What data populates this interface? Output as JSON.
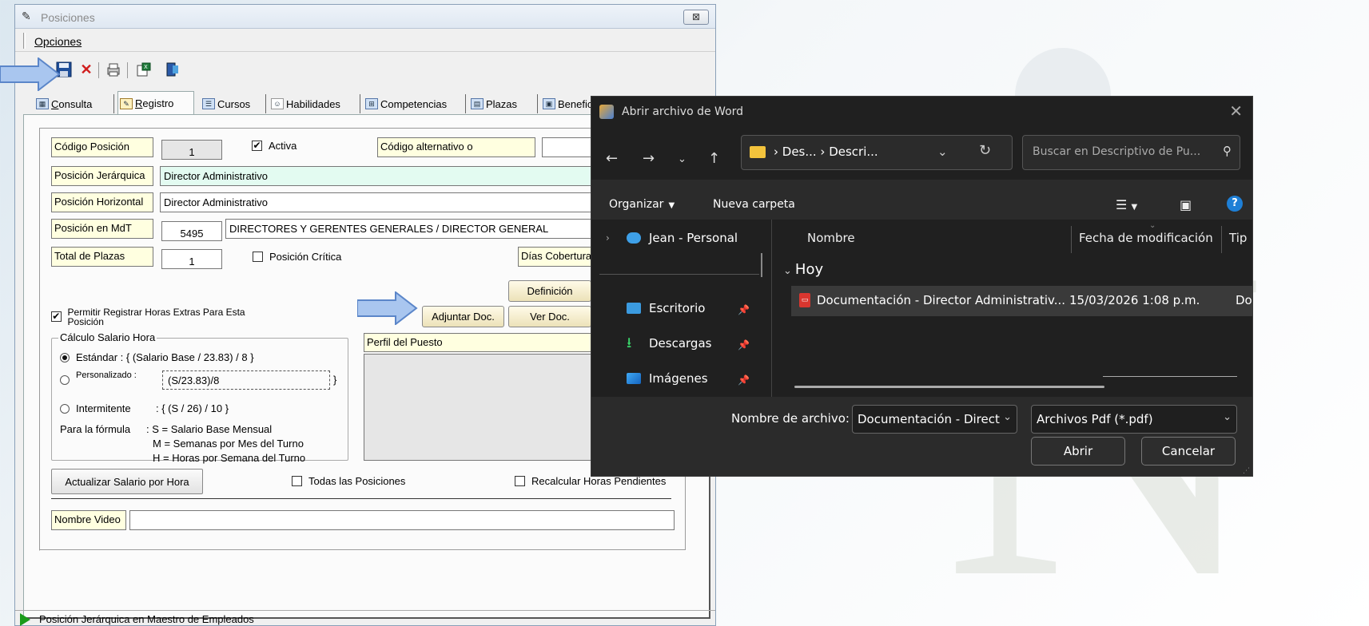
{
  "posiciones": {
    "title": "Posiciones",
    "close_label": "⊠",
    "menu": {
      "opciones": "Opciones"
    },
    "tabs": [
      {
        "label": "Consulta",
        "underline": "C",
        "rest": "onsulta"
      },
      {
        "label": "Registro",
        "underline": "R",
        "rest": "egistro"
      },
      {
        "label": "Cursos"
      },
      {
        "label": "Habilidades"
      },
      {
        "label": "Competencias"
      },
      {
        "label": "Plazas"
      },
      {
        "label": "Benefici"
      }
    ],
    "form": {
      "codigo_label": "Código Posición",
      "codigo_value": "1",
      "activa_label": "Activa",
      "codigo_alt_label": "Código alternativo o",
      "pos_jer_label": "Posición Jerárquica",
      "pos_jer_value": "Director Administrativo",
      "pos_hor_label": "Posición Horizontal",
      "pos_hor_value": "Director Administrativo",
      "pos_mdt_label": "Posición en MdT",
      "pos_mdt_code": "5495",
      "pos_mdt_desc": "DIRECTORES Y GERENTES GENERALES / DIRECTOR GENERAL",
      "total_plazas_label": "Total de Plazas",
      "total_plazas_value": "1",
      "pos_critica_label": "Posición Crítica",
      "dias_cobertura_label": "Días Cobertura",
      "definicion_btn": "Definición",
      "horas_extras_label": "Permitir Registrar Horas Extras Para Esta Posición",
      "adjuntar_btn": "Adjuntar Doc.",
      "ver_doc_btn": "Ver Doc.",
      "calculo_title": "Cálculo Salario Hora",
      "estandar_label": "Estándar : { (Salario Base / 23.83) / 8 }",
      "personalizado_label": "Personalizado :",
      "personalizado_value": "(S/23.83)/8",
      "personalizado_close": "}",
      "intermitente_label": "Intermitente",
      "intermitente_formula": ": { (S / 26) / 10 }",
      "formula_title": "Para la fórmula",
      "formula_s": ": S = Salario Base Mensual",
      "formula_m": "M = Semanas por Mes del Turno",
      "formula_h": "H = Horas por Semana del Turno",
      "perfil_label": "Perfil del Puesto",
      "actualizar_btn": "Actualizar Salario por Hora",
      "todas_label": "Todas las Posiciones",
      "recalcular_label": "Recalcular Horas Pendientes",
      "nombre_video_label": "Nombre Video"
    },
    "status": "Posición Jerárquica en Maestro de Empleados"
  },
  "dialog": {
    "title": "Abrir archivo de Word",
    "close": "✕",
    "breadcrumb": "› Des... › Descri...",
    "search_placeholder": "Buscar en Descriptivo de Pu...",
    "organizar": "Organizar",
    "nueva_carpeta": "Nueva carpeta",
    "nav": {
      "personal": "Jean - Personal",
      "escritorio": "Escritorio",
      "descargas": "Descargas",
      "imagenes": "Imágenes"
    },
    "columns": {
      "nombre": "Nombre",
      "fecha": "Fecha de modificación",
      "tipo": "Tip"
    },
    "group": "Hoy",
    "file": {
      "name": "Documentación - Director Administrativ...",
      "date": "15/03/2026 1:08 p.m.",
      "type": "Do"
    },
    "filename_label": "Nombre de archivo:",
    "filename_value": "Documentación - Direct",
    "filetype": "Archivos Pdf (*.pdf)",
    "open_btn": "Abrir",
    "cancel_btn": "Cancelar"
  },
  "colors": {
    "arrow_fill": "#a9c6ef",
    "arrow_stroke": "#5b86c9",
    "label_bg": "#ffffe0",
    "mint_bg": "#e3fbf1",
    "dialog_bg": "#202020"
  }
}
